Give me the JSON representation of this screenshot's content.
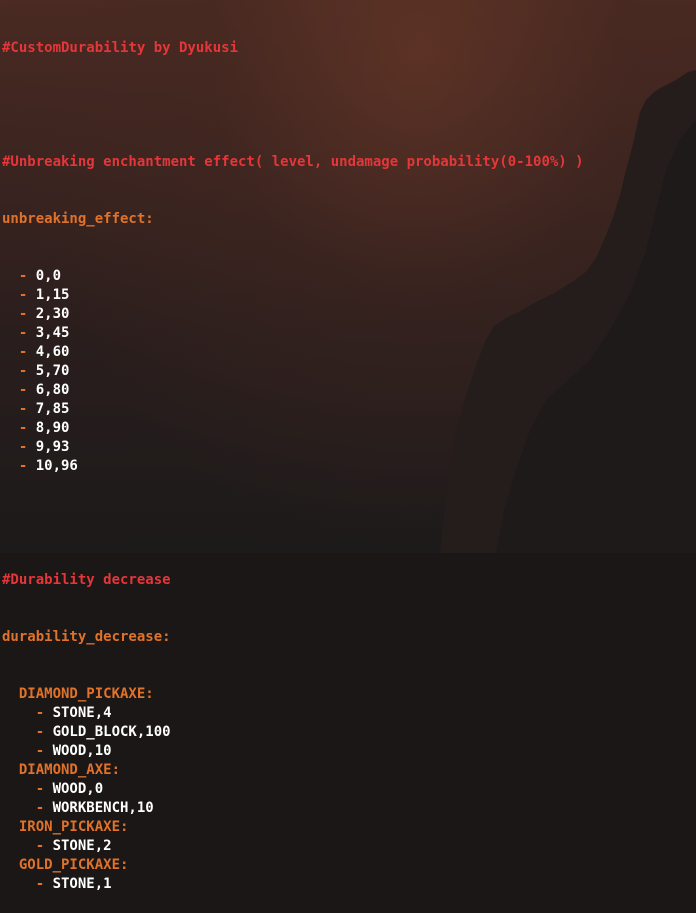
{
  "header_comment": "#CustomDurability by Dyukusi",
  "unbreaking_comment": "#Unbreaking enchantment effect( level, undamage probability(0-100%) )",
  "unbreaking_key": "unbreaking_effect:",
  "unbreaking_values": [
    "0,0",
    "1,15",
    "2,30",
    "3,45",
    "4,60",
    "5,70",
    "6,80",
    "7,85",
    "8,90",
    "9,93",
    "10,96"
  ],
  "durability_comment": "#Durability decrease",
  "durability_key": "durability_decrease:",
  "tools": [
    {
      "name": "DIAMOND_PICKAXE:",
      "items": [
        "STONE,4",
        "GOLD_BLOCK,100",
        "WOOD,10"
      ]
    },
    {
      "name": "DIAMOND_AXE:",
      "items": [
        "WOOD,0",
        "WORKBENCH,10"
      ]
    },
    {
      "name": "IRON_PICKAXE:",
      "items": [
        "STONE,2"
      ]
    },
    {
      "name": "GOLD_PICKAXE:",
      "items": [
        "STONE,1"
      ]
    }
  ],
  "colors": {
    "comment": "#e5363a",
    "key": "#e0722b",
    "value": "#ffffff"
  }
}
